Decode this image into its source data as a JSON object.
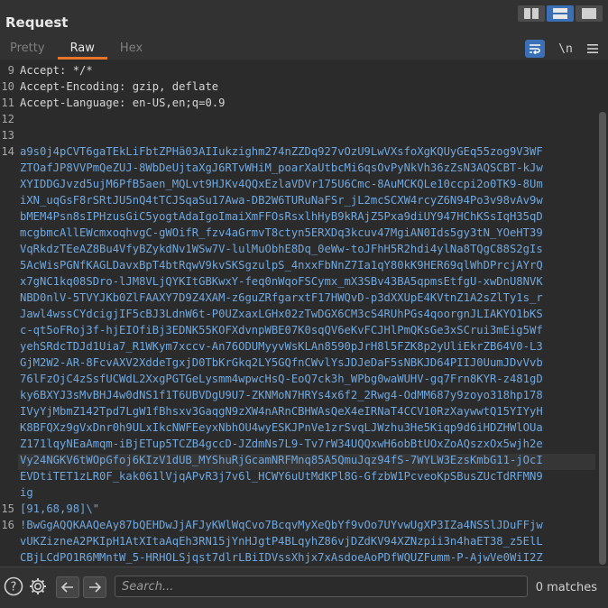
{
  "panel": {
    "title": "Request",
    "tabs": [
      "Pretty",
      "Raw",
      "Hex"
    ],
    "active_tab": "Raw",
    "tool_newline": "\\n"
  },
  "editor": {
    "header_lines": [
      {
        "num": "9",
        "text": "Accept: */*"
      },
      {
        "num": "10",
        "text": "Accept-Encoding: gzip, deflate"
      },
      {
        "num": "11",
        "text": "Accept-Language: en-US,en;q=0.9"
      },
      {
        "num": "12",
        "text": ""
      },
      {
        "num": "13",
        "text": ""
      }
    ],
    "line14_num": "14",
    "line14": [
      "a9s0j4pCVT6gaTEkLiFbtZPHä03AIIukzighm274nZZDq927vOzU9LwVXsfoXgKQUyGEq55zog9V3WF",
      "ZTOafJP8VVPmQeZUJ-8WbDeUjtaXgJ6RTvWHiM_poarXaUtbcMi6qsOvPyNkVh36zZsN3AQSCBT-kJw",
      "XYIDDGJvzd5ujM6PfB5aen_MQLvt9HJKv4QQxEzlaVDVr175U6Cmc-8AuMCKQLe10ccpi2o0TK9-8Um",
      "iXN_uqGsF8rSRtJU5nQ4tTCJSqaSu17Awa-DB2W6TURuNaFSr_jL2mcSCXW4rcyZ6N94Po3v98vAv9w",
      "bMEM4Psn8sIPHzusGiC5yogtAdaIgoImaiXmFFOsRsxlhHyB9kRAjZ5Pxa9diUY947HChKSsIqH35qD",
      "mcgbmcAllEWcmxoqhvgC-gWOifR_fzv4aGrmvT8ctyn5ERXDq3kcuv47MgiAN0Ids5gy3tN_YOeHT39",
      "VqRkdzTEeAZ8Bu4VfyBZykdNv1WSw7V-lulMuObhE8Dq_0eWw-toJFhH5R2hdi4ylNa8TQgC88S2gIs",
      "5AcWisPGNfKAGLDavxBpT4btRqwV9kvSKSgzulpS_4nxxFbNnZ7Ia1qY80kK9HER69qlWhDPrcjAYrQ",
      "x7gNC1kq08SDro-lJM8VLjQYKItGBKwxY-feq0nWqoFSCymx_mX3SBv43BA5qpmsEtfgU-xwDnU8NVK",
      "NBD0nlV-5TVYJKb0ZlFAAXY7D9Z4XAM-z6guZRfgarxtF17HWQvD-p3dXXUpE4KVtnZ1A2sZlTy1s_r",
      "Jawl4wssCYdcigjIF5cBJ3LdnW6t-P0UZxaxLGHx02zTwDGX6CM3cS4RUhPGs4qoorgnJLIAKYO1bKS",
      "c-qt5oFRoj3f-hjEIOfiBj3EDNK55KOFXdvnpWBE07K0sqQV6eKvFCJHlPmQKsGe3xSCrui3mEig5Wf",
      "yehSRdcTDJd1Uia7_R1WKym7xccv-An76ODUMyyvWsKLAn8590pJrH8l5FZK8p2yUliEkrZB64V0-L3",
      "GjM2W2-AR-8FcvAXV2XddeTgxjD0TbKrGkq2LY5GQfnCWvlYsJDJeDaF5sNBKJD64PIIJ0UumJDvVvb",
      "76lFzOjC4zSsfUCWdL2XxgPGTGeLysmm4wpwcHsQ-EoQ7ck3h_WPbg0waWUHV-gq7Frn8KYR-z481gD",
      "ky6BXYJ3sMvBHJ4w0dNS1f1T6UBVDgU9U7-ZKNMoN7HRYs4x6f2_2Rwg4-OdMM687y9zoyo318hp178",
      "IVyYjMbmZ142Tpd7LgW1fBhsxv3GaqgN9zXW4nARnCBHWAsQeX4eIRNaT4CCV10RzXaywwtQ15YIYyH",
      "K8BFQXz9gVxDnr0h9ULxIkcNWFEeyxNbhOU4wyESKJPnVe1zrSvqLJWzhu3He5Kiqp9d6iHDZHWlOUa",
      "Z171lqyNEaAmqm-iBjETup5TCZB4gccD-JZdmNs7L9-Tv7rW34UQQxwH6obBtUOxZoAQszxOx5wjh2e",
      "Vy24NGKV6tWOpGfoj6KIzV1dUB_MYShuRjGcamNRFMnq85A5QmuJqz94fS-7WYLW3EzsKmbG11-jOcI",
      "EVDtiTET1zLR0F_kak061lVjqAPvR3j7v6l_HCWY6uUtMdKPl8G-GfzbW1PcveoKpSBusZUcTdRFMN9",
      "ig"
    ],
    "line15_num": "15",
    "line15": "[91,68,98]\\\"",
    "line16_num": "16",
    "line16": [
      "!BwGgAQQKAAQeAy87bQEHDwJjAFJyKWlWqCvo7BcqvMyXeQbYf9vOo7UYvwUgXP3IZa4NSSlJDuFFjw",
      "vUKZizneA2PKIpH1AtXItaAqEh3RN15jYnHJgtP4BLqyhZ86vjDZdKV94XZNzpii3n4haET38_z5ElL",
      "CBjLCdPO1R6MMntW_5-HRHOLSjqst7dlrLBiIDVssXhjx7xAsdoeAoPDfWQUZFumm-P-AjwVe0WiI2Z"
    ]
  },
  "footer": {
    "search_placeholder": "Search...",
    "matches": "0 matches"
  },
  "colors": {
    "accent_tab": "#e8742c",
    "active_button": "#3b6fb6",
    "body_text": "#6fa8e0"
  }
}
